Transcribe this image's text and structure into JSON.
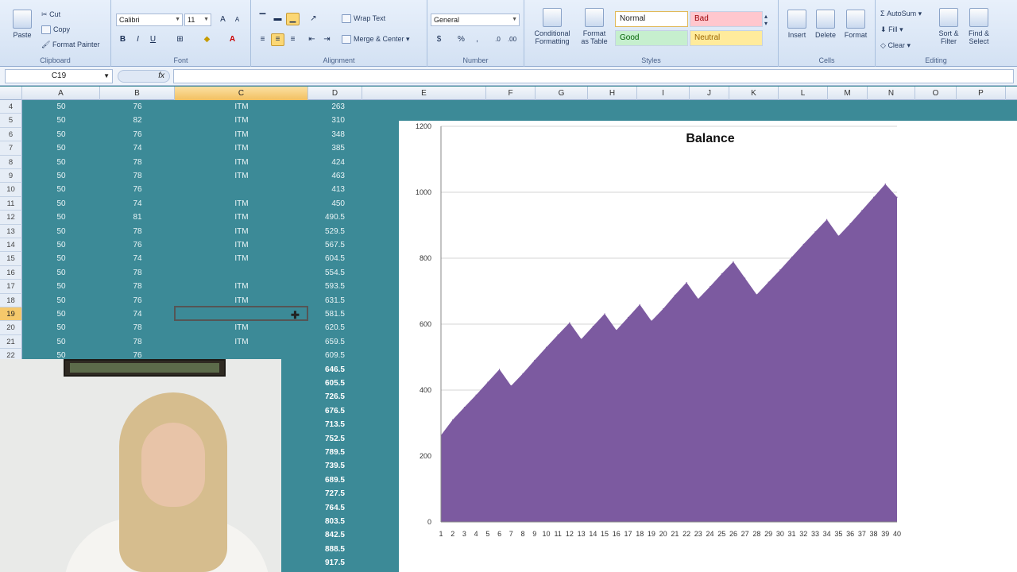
{
  "ribbon": {
    "clipboard": {
      "paste": "Paste",
      "cut": "Cut",
      "copy": "Copy",
      "format_painter": "Format Painter",
      "label": "Clipboard"
    },
    "font": {
      "name": "Calibri",
      "size": "11",
      "label": "Font"
    },
    "alignment": {
      "wrap_text": "Wrap Text",
      "merge_center": "Merge & Center",
      "label": "Alignment"
    },
    "number": {
      "format": "General",
      "label": "Number"
    },
    "styles": {
      "conditional": "Conditional\nFormatting",
      "format_table": "Format\nas Table",
      "normal": "Normal",
      "bad": "Bad",
      "good": "Good",
      "neutral": "Neutral",
      "label": "Styles"
    },
    "cells": {
      "insert": "Insert",
      "delete": "Delete",
      "format": "Format",
      "label": "Cells"
    },
    "editing": {
      "autosum": "AutoSum",
      "fill": "Fill",
      "clear": "Clear",
      "sort_filter": "Sort &\nFilter",
      "find_select": "Find &\nSelect",
      "label": "Editing"
    }
  },
  "formula_bar": {
    "name_box": "C19",
    "formula": ""
  },
  "columns": [
    "A",
    "B",
    "C",
    "D",
    "E",
    "F",
    "G",
    "H",
    "I",
    "J",
    "K",
    "L",
    "M",
    "N",
    "O",
    "P"
  ],
  "rows": [
    {
      "n": "4",
      "a": "50",
      "b": "76",
      "c": "ITM",
      "d": "263"
    },
    {
      "n": "5",
      "a": "50",
      "b": "82",
      "c": "ITM",
      "d": "310"
    },
    {
      "n": "6",
      "a": "50",
      "b": "76",
      "c": "ITM",
      "d": "348"
    },
    {
      "n": "7",
      "a": "50",
      "b": "74",
      "c": "ITM",
      "d": "385"
    },
    {
      "n": "8",
      "a": "50",
      "b": "78",
      "c": "ITM",
      "d": "424"
    },
    {
      "n": "9",
      "a": "50",
      "b": "78",
      "c": "ITM",
      "d": "463"
    },
    {
      "n": "10",
      "a": "50",
      "b": "76",
      "c": "",
      "d": "413"
    },
    {
      "n": "11",
      "a": "50",
      "b": "74",
      "c": "ITM",
      "d": "450"
    },
    {
      "n": "12",
      "a": "50",
      "b": "81",
      "c": "ITM",
      "d": "490.5"
    },
    {
      "n": "13",
      "a": "50",
      "b": "78",
      "c": "ITM",
      "d": "529.5"
    },
    {
      "n": "14",
      "a": "50",
      "b": "76",
      "c": "ITM",
      "d": "567.5"
    },
    {
      "n": "15",
      "a": "50",
      "b": "74",
      "c": "ITM",
      "d": "604.5"
    },
    {
      "n": "16",
      "a": "50",
      "b": "78",
      "c": "",
      "d": "554.5"
    },
    {
      "n": "17",
      "a": "50",
      "b": "78",
      "c": "ITM",
      "d": "593.5"
    },
    {
      "n": "18",
      "a": "50",
      "b": "76",
      "c": "ITM",
      "d": "631.5"
    },
    {
      "n": "19",
      "a": "50",
      "b": "74",
      "c": "",
      "d": "581.5"
    },
    {
      "n": "20",
      "a": "50",
      "b": "78",
      "c": "ITM",
      "d": "620.5"
    },
    {
      "n": "21",
      "a": "50",
      "b": "78",
      "c": "ITM",
      "d": "659.5"
    },
    {
      "n": "22",
      "a": "50",
      "b": "76",
      "c": "",
      "d": "609.5"
    },
    {
      "n": "",
      "a": "",
      "b": "",
      "c": "",
      "d": "646.5"
    },
    {
      "n": "",
      "a": "",
      "b": "",
      "c": "",
      "d": "605.5"
    },
    {
      "n": "",
      "a": "",
      "b": "",
      "c": "",
      "d": "726.5"
    },
    {
      "n": "",
      "a": "",
      "b": "",
      "c": "",
      "d": "676.5"
    },
    {
      "n": "",
      "a": "",
      "b": "",
      "c": "",
      "d": "713.5"
    },
    {
      "n": "",
      "a": "",
      "b": "",
      "c": "",
      "d": "752.5"
    },
    {
      "n": "",
      "a": "",
      "b": "",
      "c": "",
      "d": "789.5"
    },
    {
      "n": "",
      "a": "",
      "b": "",
      "c": "",
      "d": "739.5"
    },
    {
      "n": "",
      "a": "",
      "b": "",
      "c": "",
      "d": "689.5"
    },
    {
      "n": "",
      "a": "",
      "b": "",
      "c": "",
      "d": "727.5"
    },
    {
      "n": "",
      "a": "",
      "b": "",
      "c": "",
      "d": "764.5"
    },
    {
      "n": "",
      "a": "",
      "b": "",
      "c": "",
      "d": "803.5"
    },
    {
      "n": "",
      "a": "",
      "b": "",
      "c": "",
      "d": "842.5"
    },
    {
      "n": "",
      "a": "",
      "b": "",
      "c": "",
      "d": "888.5"
    },
    {
      "n": "",
      "a": "",
      "b": "",
      "c": "",
      "d": "917.5"
    }
  ],
  "colors": {
    "sheet_bg": "#3c8a97",
    "series": "#7c5aa0",
    "selected_header": "#f5c86b"
  },
  "chart_data": {
    "type": "area",
    "title": "Balance",
    "xlabel": "",
    "ylabel": "",
    "ylim": [
      0,
      1200
    ],
    "yticks": [
      0,
      200,
      400,
      600,
      800,
      1000,
      1200
    ],
    "grid": true,
    "legend": "none",
    "x": [
      1,
      2,
      3,
      4,
      5,
      6,
      7,
      8,
      9,
      10,
      11,
      12,
      13,
      14,
      15,
      16,
      17,
      18,
      19,
      20,
      21,
      22,
      23,
      24,
      25,
      26,
      27,
      28,
      29,
      30,
      31,
      32,
      33,
      34,
      35,
      36,
      37,
      38,
      39,
      40
    ],
    "values": [
      263,
      310,
      348,
      385,
      424,
      463,
      413,
      450,
      490.5,
      529.5,
      567.5,
      604.5,
      554.5,
      593.5,
      631.5,
      581.5,
      620.5,
      659.5,
      609.5,
      646.5,
      688,
      726.5,
      676.5,
      713.5,
      752.5,
      789.5,
      739.5,
      689.5,
      727.5,
      764.5,
      803.5,
      842.5,
      880,
      917.5,
      867.5,
      905,
      945,
      985,
      1025,
      985
    ]
  }
}
